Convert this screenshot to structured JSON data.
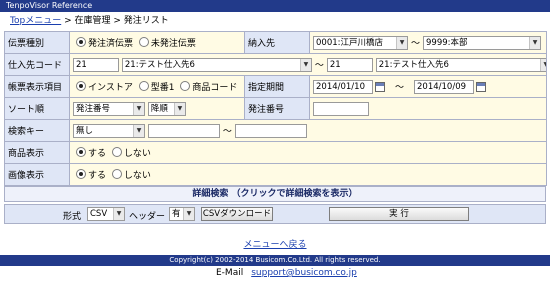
{
  "window": {
    "title": "TenpoVisor Reference"
  },
  "breadcrumb": {
    "top": "Topメニュー",
    "sep": " > ",
    "section": "在庫管理",
    "page": "発注リスト"
  },
  "fields": {
    "denpyo": {
      "label": "伝票種別",
      "opt1": "発注済伝票",
      "opt2": "未発注伝票",
      "selected": "発注済伝票"
    },
    "nonyu": {
      "label": "納入先",
      "from": "0001:江戸川橋店",
      "to": "9999:本部"
    },
    "shiire": {
      "label": "仕入先コード",
      "from_code": "21",
      "from_name": "21:テスト仕入先6",
      "to_code": "21",
      "to_name": "21:テスト仕入先6"
    },
    "display": {
      "label": "帳票表示項目",
      "opt1": "インストア",
      "opt2": "型番1",
      "opt3": "商品コード",
      "selected": "インストア"
    },
    "period": {
      "label": "指定期間",
      "from": "2014/01/10",
      "to": "2014/10/09"
    },
    "sort": {
      "label": "ソート順",
      "key": "発注番号",
      "order": "降順"
    },
    "order_no": {
      "label": "発注番号",
      "value": ""
    },
    "search": {
      "label": "検索キー",
      "key": "無し",
      "from": "",
      "to": ""
    },
    "product": {
      "label": "商品表示",
      "opt1": "する",
      "opt2": "しない",
      "selected": "する"
    },
    "image": {
      "label": "画像表示",
      "opt1": "する",
      "opt2": "しない",
      "selected": "する"
    }
  },
  "tilde": "〜",
  "detail_search": "詳細検索 （クリックで詳細検索を表示）",
  "export": {
    "format_label": "形式",
    "format": "CSV",
    "header_label": "ヘッダー",
    "header": "有",
    "download": "CSVダウンロード",
    "run": "実 行"
  },
  "footer": {
    "back": "メニューへ戻る",
    "copyright": "Copyright(c) 2002-2014 Busicom.Co.Ltd. All rights reserved.",
    "email_label": "E-Mail",
    "email": "support@busicom.co.jp"
  }
}
